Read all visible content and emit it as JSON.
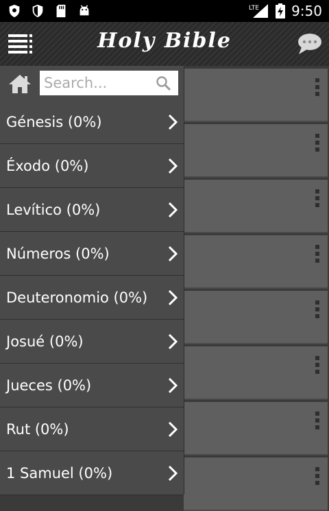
{
  "status_bar": {
    "network": "LTE",
    "time": "9:50",
    "icons": [
      "shield-icon",
      "shield-icon",
      "sd-card-icon",
      "android-icon",
      "signal-icon",
      "battery-charging-icon"
    ]
  },
  "header": {
    "title": "Holy Bible",
    "menu_icon": "list-menu-icon",
    "chat_icon": "speech-bubble-icon"
  },
  "drawer": {
    "home_icon": "home-icon",
    "search": {
      "value": "",
      "placeholder": "Search..."
    },
    "books": [
      {
        "label": "Génesis (0%)"
      },
      {
        "label": "Éxodo (0%)"
      },
      {
        "label": "Levítico (0%)"
      },
      {
        "label": "Números (0%)"
      },
      {
        "label": "Deuteronomio (0%)"
      },
      {
        "label": "Josué (0%)"
      },
      {
        "label": "Jueces (0%)"
      },
      {
        "label": "Rut (0%)"
      },
      {
        "label": "1 Samuel (0%)"
      }
    ]
  },
  "colors": {
    "statusbar": "#000000",
    "actionbar": "#2b2b2b",
    "drawer": "#4a4a4a",
    "card": "#5f5f5f",
    "text": "#ffffff"
  }
}
